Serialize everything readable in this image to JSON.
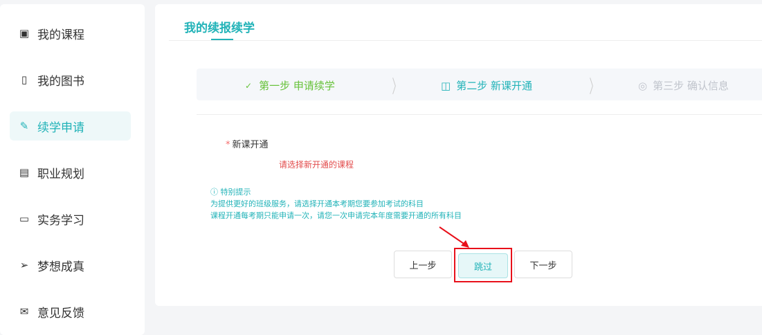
{
  "sidebar": {
    "items": [
      {
        "label": "我的课程",
        "icon": "course-icon"
      },
      {
        "label": "我的图书",
        "icon": "book-icon"
      },
      {
        "label": "续学申请",
        "icon": "edit-icon",
        "active": true
      },
      {
        "label": "职业规划",
        "icon": "badge-icon"
      },
      {
        "label": "实务学习",
        "icon": "monitor-icon"
      },
      {
        "label": "梦想成真",
        "icon": "paper-plane-icon"
      },
      {
        "label": "意见反馈",
        "icon": "mail-icon"
      }
    ]
  },
  "main": {
    "title": "我的续报续学",
    "steps": [
      {
        "label": "第一步 申请续学",
        "icon": "check-icon",
        "state": "done"
      },
      {
        "label": "第二步 新课开通",
        "icon": "book-open-icon",
        "state": "current"
      },
      {
        "label": "第三步 确认信息",
        "icon": "eye-icon",
        "state": "pending"
      }
    ],
    "field_label": "新课开通",
    "required_mark": "*",
    "error": "请选择新开通的课程",
    "tips": {
      "title": "特别提示",
      "lines": [
        "为提供更好的班级服务，请选择开通本考期您要参加考试的科目",
        "课程开通每考期只能申请一次，请您一次申请完本年度需要开通的所有科目"
      ]
    },
    "buttons": {
      "prev": "上一步",
      "skip": "跳过",
      "next": "下一步"
    }
  },
  "colors": {
    "accent": "#22b3b8",
    "done": "#67c23a",
    "error": "#e24b4b",
    "highlight": "#e8101a"
  }
}
